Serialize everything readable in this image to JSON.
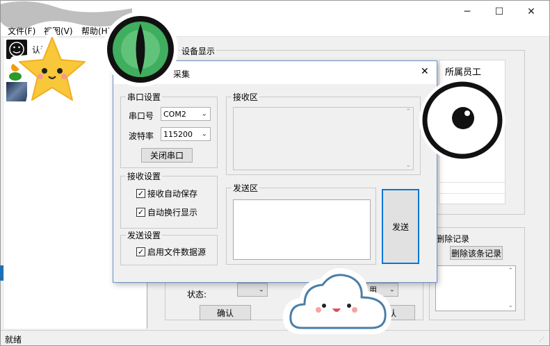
{
  "window": {
    "title_icons": {
      "minimize": "─",
      "maximize": "☐",
      "close": "✕"
    }
  },
  "menu": {
    "file": "文件(F)",
    "view": "视图(V)",
    "help": "帮助(H)"
  },
  "tree": {
    "item1": "认证"
  },
  "main": {
    "device_group_title": "设备显示",
    "column_header": "所属员工",
    "delete_group_title": "删除记录",
    "delete_button": "删除该条记录",
    "status_label": "状态:",
    "confirm_button": "确认",
    "confirm_button_2": "认",
    "combo_partial": "用"
  },
  "statusbar": {
    "text": "就绪"
  },
  "dialog": {
    "title": "采集",
    "close": "✕",
    "serial_group": {
      "title": "串口设置",
      "port_label": "串口号",
      "port_value": "COM2",
      "baud_label": "波特率",
      "baud_value": "115200",
      "close_port_button": "关闭串口"
    },
    "receive_settings": {
      "title": "接收设置",
      "auto_save": "接收自动保存",
      "auto_newline": "自动换行显示"
    },
    "send_settings": {
      "title": "发送设置",
      "file_source": "启用文件数据源"
    },
    "receive_area_title": "接收区",
    "send_area_title": "发送区",
    "send_button": "发送"
  },
  "colors": {
    "accent_blue": "#0078d7",
    "window_bg": "#f0f0f0",
    "bottom_band": "#1e6fb5"
  }
}
